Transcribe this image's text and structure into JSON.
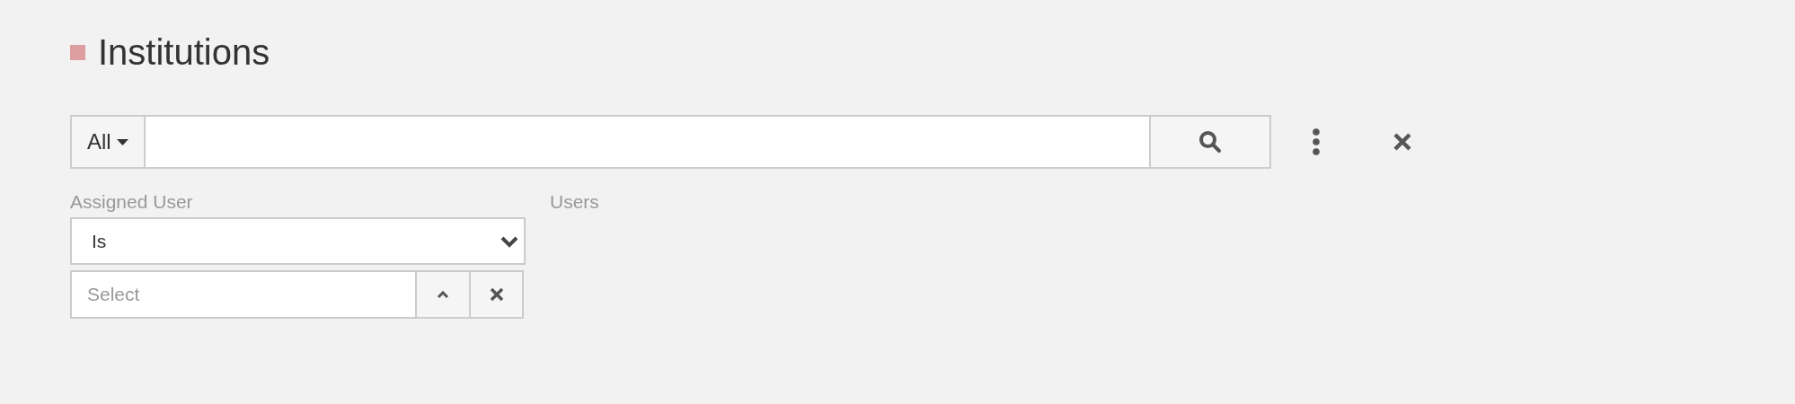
{
  "header": {
    "title": "Institutions"
  },
  "search_bar": {
    "scope": "All"
  },
  "filters": [
    {
      "label": "Assigned User",
      "operator": "Is",
      "placeholder": "Select"
    }
  ],
  "column_2": {
    "label": "Users"
  }
}
